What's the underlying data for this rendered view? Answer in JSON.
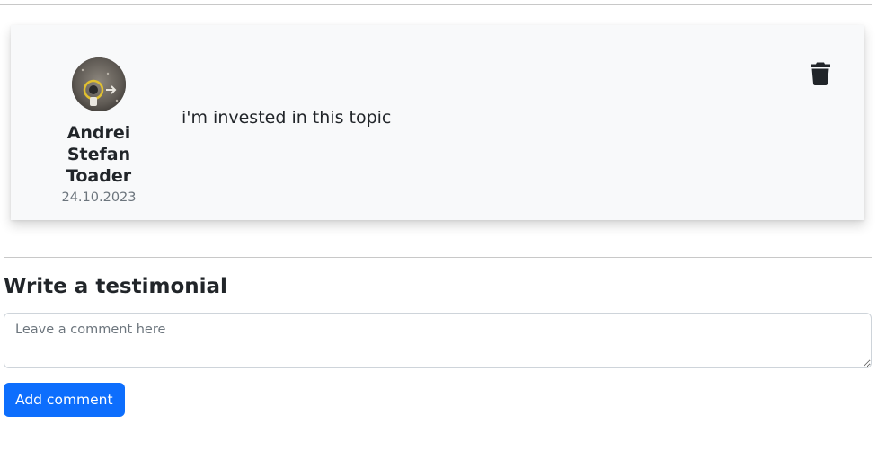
{
  "testimonial": {
    "author_name": "Andrei Stefan Toader",
    "date": "24.10.2023",
    "text": "i'm invested in this topic",
    "delete_icon": "trash-icon",
    "avatar_icon": "user-avatar"
  },
  "form": {
    "title": "Write a testimonial",
    "placeholder": "Leave a comment here",
    "value": "",
    "submit_label": "Add comment"
  },
  "colors": {
    "primary": "#0d6efd",
    "card_background": "#f8f9fa",
    "muted_text": "#6c757d"
  }
}
